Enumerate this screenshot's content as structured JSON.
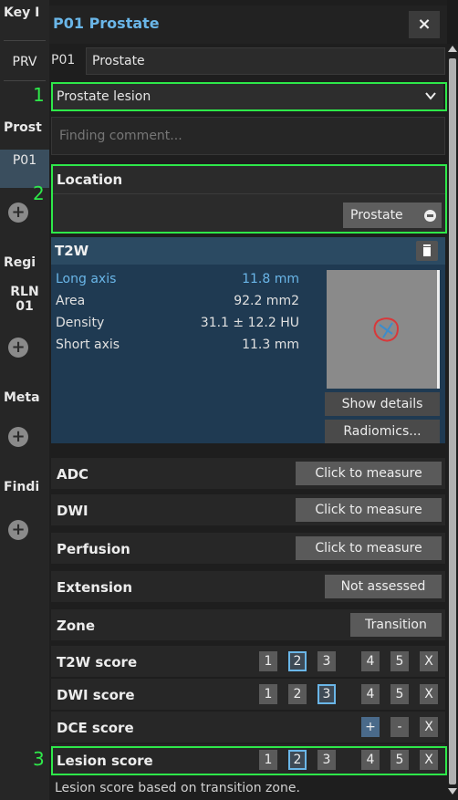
{
  "left_panel": {
    "key_label": "Key I",
    "prv_label": "PRV",
    "prost_label": "Prost",
    "p01_label": "P01",
    "regi_label": "Regi",
    "rln_label": "RLN",
    "rln_num": "01",
    "meta_label": "Meta",
    "findi_label": "Findi",
    "add_glyph": "+"
  },
  "panel": {
    "title": "P01 Prostate",
    "close_glyph": "×",
    "id_label": "P01",
    "name_value": "Prostate",
    "finding_type": "Prostate lesion",
    "comment_placeholder": "Finding comment...",
    "location": {
      "title": "Location",
      "value": "Prostate"
    },
    "t2w": {
      "title": "T2W",
      "measurements": [
        {
          "name": "Long axis",
          "value": "11.8 mm",
          "highlight": true
        },
        {
          "name": "Area",
          "value": "92.2 mm2",
          "highlight": false
        },
        {
          "name": "Density",
          "value": "31.1 ± 12.2 HU",
          "highlight": false
        },
        {
          "name": "Short axis",
          "value": "11.3 mm",
          "highlight": false
        }
      ],
      "show_details": "Show details",
      "radiomics": "Radiomics..."
    },
    "rows": [
      {
        "label": "ADC",
        "button": "Click to measure"
      },
      {
        "label": "DWI",
        "button": "Click to measure"
      },
      {
        "label": "Perfusion",
        "button": "Click to measure"
      },
      {
        "label": "Extension",
        "button": "Not assessed"
      },
      {
        "label": "Zone",
        "button": "Transition"
      }
    ],
    "scores": [
      {
        "label": "T2W score",
        "options": [
          "1",
          "2",
          "3",
          "4",
          "5",
          "X"
        ],
        "selected": "2"
      },
      {
        "label": "DWI score",
        "options": [
          "1",
          "2",
          "3",
          "4",
          "5",
          "X"
        ],
        "selected": "3"
      },
      {
        "label": "DCE score",
        "options": [
          "+",
          "-",
          "X"
        ],
        "selected": "+"
      },
      {
        "label": "Lesion score",
        "options": [
          "1",
          "2",
          "3",
          "4",
          "5",
          "X"
        ],
        "selected": "2"
      }
    ],
    "note": "Lesion score based on transition zone."
  },
  "annotations": {
    "one": "1",
    "two": "2",
    "three": "3"
  },
  "colors": {
    "accent": "#6ab6e8",
    "annotation": "#2ee84a",
    "measure_highlight": "#6ab6e8",
    "lesion_outline": "#d8383a"
  }
}
